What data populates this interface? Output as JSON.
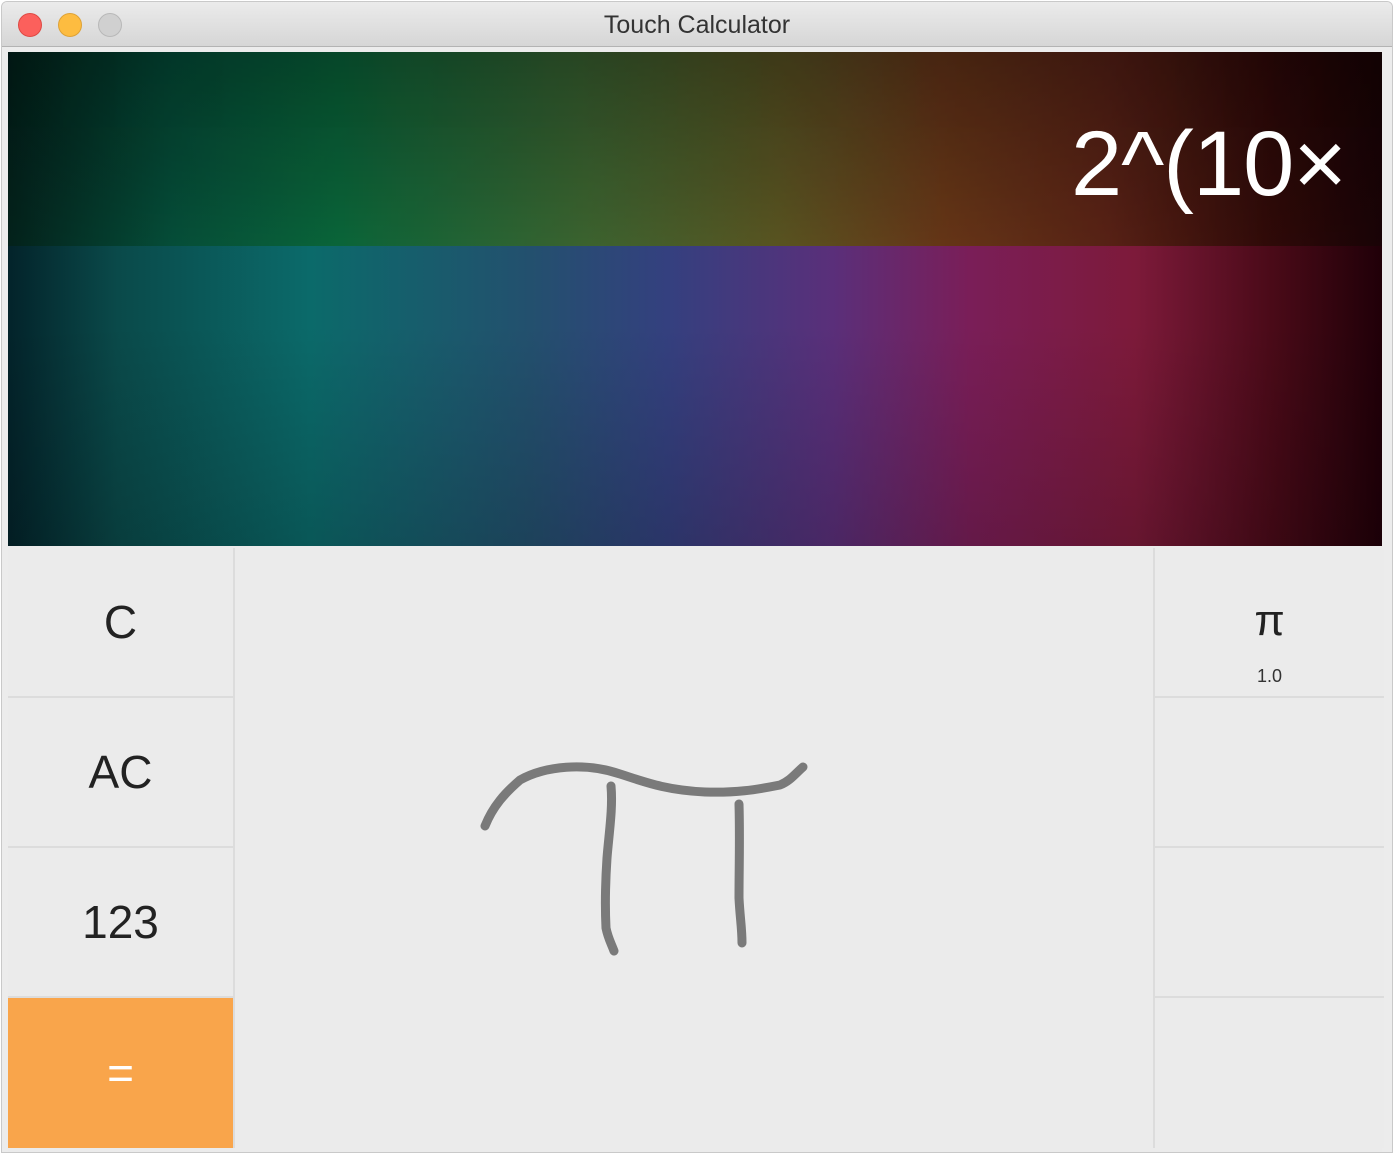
{
  "window": {
    "title": "Touch Calculator"
  },
  "display": {
    "expression": "2^(10×"
  },
  "keys": {
    "clear": "C",
    "all_clear": "AC",
    "numbers": "123",
    "equals": "="
  },
  "suggestions": [
    {
      "symbol": "π",
      "score": "1.0"
    },
    {
      "symbol": "",
      "score": ""
    },
    {
      "symbol": "",
      "score": ""
    },
    {
      "symbol": "",
      "score": ""
    }
  ],
  "colors": {
    "equals_key": "#f9a54b",
    "stroke": "#7a7a7a"
  }
}
